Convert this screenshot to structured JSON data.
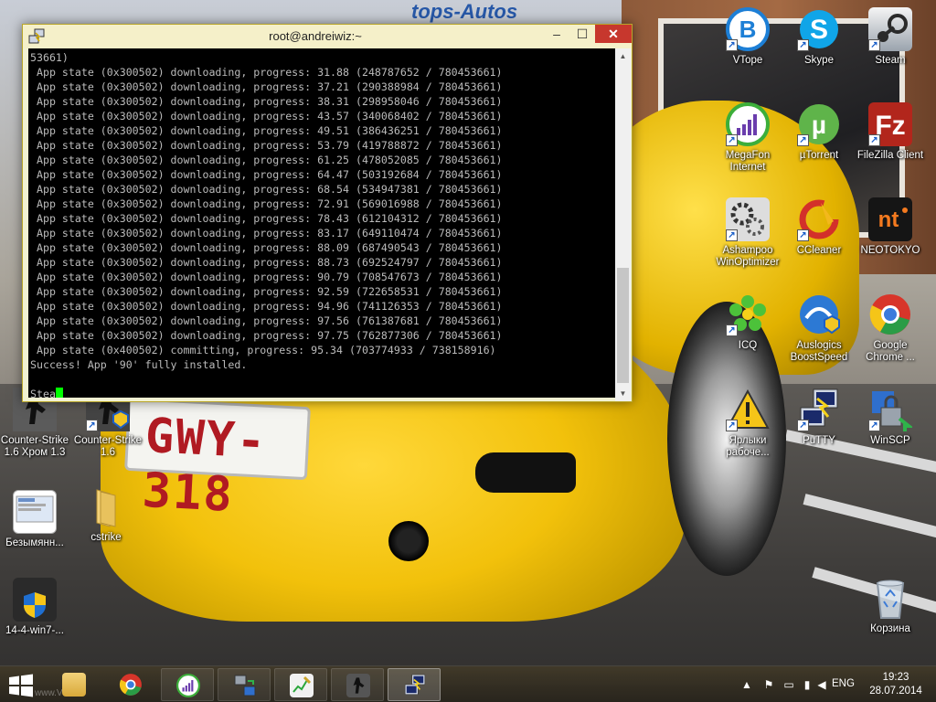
{
  "window": {
    "title": "root@andreiwiz:~",
    "controls": {
      "minimize": "–",
      "maximize": "☐",
      "close": "✕"
    }
  },
  "terminal": {
    "lines": [
      "53661)",
      " App state (0x300502) downloading, progress: 31.88 (248787652 / 780453661)",
      " App state (0x300502) downloading, progress: 37.21 (290388984 / 780453661)",
      " App state (0x300502) downloading, progress: 38.31 (298958046 / 780453661)",
      " App state (0x300502) downloading, progress: 43.57 (340068402 / 780453661)",
      " App state (0x300502) downloading, progress: 49.51 (386436251 / 780453661)",
      " App state (0x300502) downloading, progress: 53.79 (419788872 / 780453661)",
      " App state (0x300502) downloading, progress: 61.25 (478052085 / 780453661)",
      " App state (0x300502) downloading, progress: 64.47 (503192684 / 780453661)",
      " App state (0x300502) downloading, progress: 68.54 (534947381 / 780453661)",
      " App state (0x300502) downloading, progress: 72.91 (569016988 / 780453661)",
      " App state (0x300502) downloading, progress: 78.43 (612104312 / 780453661)",
      " App state (0x300502) downloading, progress: 83.17 (649110474 / 780453661)",
      " App state (0x300502) downloading, progress: 88.09 (687490543 / 780453661)",
      " App state (0x300502) downloading, progress: 88.73 (692524797 / 780453661)",
      " App state (0x300502) downloading, progress: 90.79 (708547673 / 780453661)",
      " App state (0x300502) downloading, progress: 92.59 (722658531 / 780453661)",
      " App state (0x300502) downloading, progress: 94.96 (741126353 / 780453661)",
      " App state (0x300502) downloading, progress: 97.56 (761387681 / 780453661)",
      " App state (0x300502) downloading, progress: 97.75 (762877306 / 780453661)",
      " App state (0x400502) committing, progress: 95.34 (703774933 / 738158916)",
      "Success! App '90' fully installed."
    ],
    "prompt_text": "Stea",
    "text_color": "#bbbbbb",
    "cursor_color": "#00ff00"
  },
  "wallpaper": {
    "plate_text": "GWY-318",
    "banner_text": "tops-Autos"
  },
  "desktop_icons": {
    "left": [
      {
        "label": "Counter-Strike 1.6 Хром 1.3",
        "icon": "counter-strike-icon"
      },
      {
        "label": "Counter-Strike 1.6",
        "icon": "counter-strike-icon"
      },
      {
        "label": "Безымянн...",
        "icon": "screenshot-file-icon"
      },
      {
        "label": "cstrike",
        "icon": "folder-icon"
      },
      {
        "label": "14-4-win7-...",
        "icon": "shield-installer-icon"
      }
    ],
    "right": [
      {
        "label": "VTope",
        "icon": "vtope-icon"
      },
      {
        "label": "Skype",
        "icon": "skype-icon"
      },
      {
        "label": "Steam",
        "icon": "steam-icon"
      },
      {
        "label": "MegaFon Internet",
        "icon": "megafon-icon"
      },
      {
        "label": "µTorrent",
        "icon": "utorrent-icon"
      },
      {
        "label": "FileZilla Client",
        "icon": "filezilla-icon"
      },
      {
        "label": "Ashampoo WinOptimizer",
        "icon": "ashampoo-icon"
      },
      {
        "label": "CCleaner",
        "icon": "ccleaner-icon"
      },
      {
        "label": "NEOTOKYO",
        "icon": "neotokyo-icon"
      },
      {
        "label": "ICQ",
        "icon": "icq-icon"
      },
      {
        "label": "Auslogics BoostSpeed",
        "icon": "auslogics-icon"
      },
      {
        "label": "Google Chrome ...",
        "icon": "chrome-icon"
      },
      {
        "label": "Ярлыки рабоче...",
        "icon": "warning-shortcuts-icon"
      },
      {
        "label": "PuTTY",
        "icon": "putty-icon"
      },
      {
        "label": "WinSCP",
        "icon": "winscp-icon"
      },
      {
        "label": "Корзина",
        "icon": "recycle-bin-icon"
      }
    ]
  },
  "taskbar": {
    "watermark": "www.VE...ru",
    "items": [
      {
        "icon": "file-explorer-icon"
      },
      {
        "icon": "chrome-icon"
      },
      {
        "icon": "megafon-icon"
      },
      {
        "icon": "network-transfer-icon"
      },
      {
        "icon": "notepad-chart-icon"
      },
      {
        "icon": "counter-strike-icon"
      },
      {
        "icon": "putty-icon"
      }
    ],
    "language": "ENG",
    "time": "19:23",
    "date": "28.07.2014"
  }
}
